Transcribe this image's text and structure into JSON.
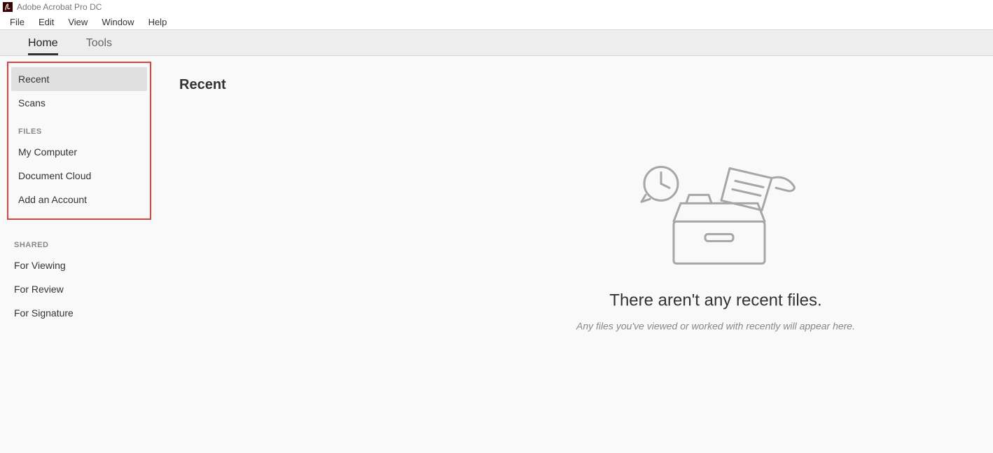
{
  "titlebar": {
    "app_name": "Adobe Acrobat Pro DC"
  },
  "menubar": {
    "items": [
      "File",
      "Edit",
      "View",
      "Window",
      "Help"
    ]
  },
  "tabs": {
    "home": "Home",
    "tools": "Tools"
  },
  "sidebar": {
    "recent": "Recent",
    "scans": "Scans",
    "files_header": "FILES",
    "my_computer": "My Computer",
    "document_cloud": "Document Cloud",
    "add_account": "Add an Account",
    "shared_header": "SHARED",
    "for_viewing": "For Viewing",
    "for_review": "For Review",
    "for_signature": "For Signature"
  },
  "main": {
    "title": "Recent",
    "empty_headline": "There aren't any recent files.",
    "empty_sub": "Any files you've viewed or worked with recently will appear here."
  }
}
